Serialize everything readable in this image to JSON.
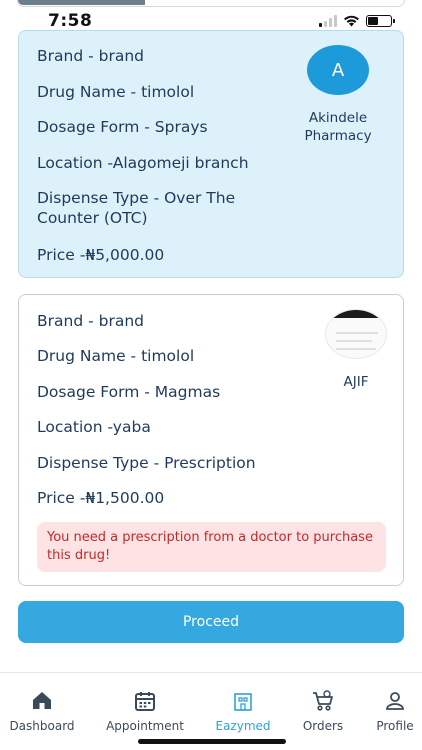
{
  "status_bar": {
    "time": "7:58"
  },
  "top_tab": {
    "progress_fraction": 0.33
  },
  "battery": {
    "level_fraction": 0.45
  },
  "cards": [
    {
      "brand": "Brand - brand",
      "drug_name": "Drug Name - timolol",
      "dosage_form": "Dosage Form - Sprays",
      "location": "Location -Alagomeji branch",
      "dispense_type": "Dispense Type - Over The Counter (OTC)",
      "price": "Price -₦5,000.00",
      "pharmacy": {
        "initial": "A",
        "name": "Akindele Pharmacy"
      }
    },
    {
      "brand": "Brand - brand",
      "drug_name": "Drug Name - timolol",
      "dosage_form": "Dosage Form - Magmas",
      "location": "Location -yaba",
      "dispense_type": "Dispense Type - Prescription",
      "price": "Price -₦1,500.00",
      "pharmacy": {
        "name": "AJIF"
      },
      "alert": "You need a prescription from a doctor to purchase this drug!"
    }
  ],
  "proceed_label": "Proceed",
  "nav": [
    {
      "label": "Dashboard",
      "icon": "home-icon"
    },
    {
      "label": "Appointment",
      "icon": "calendar-icon"
    },
    {
      "label": "Eazymed",
      "icon": "hospital-icon",
      "active": true
    },
    {
      "label": "Orders",
      "icon": "cart-icon"
    },
    {
      "label": "Profile",
      "icon": "user-icon"
    }
  ],
  "colors": {
    "accent": "#35a8e0",
    "card_blue": "#ddf1fa",
    "alert_bg": "#fde3e3",
    "alert_text": "#c62828",
    "avatar_blue": "#1d9ad9"
  }
}
